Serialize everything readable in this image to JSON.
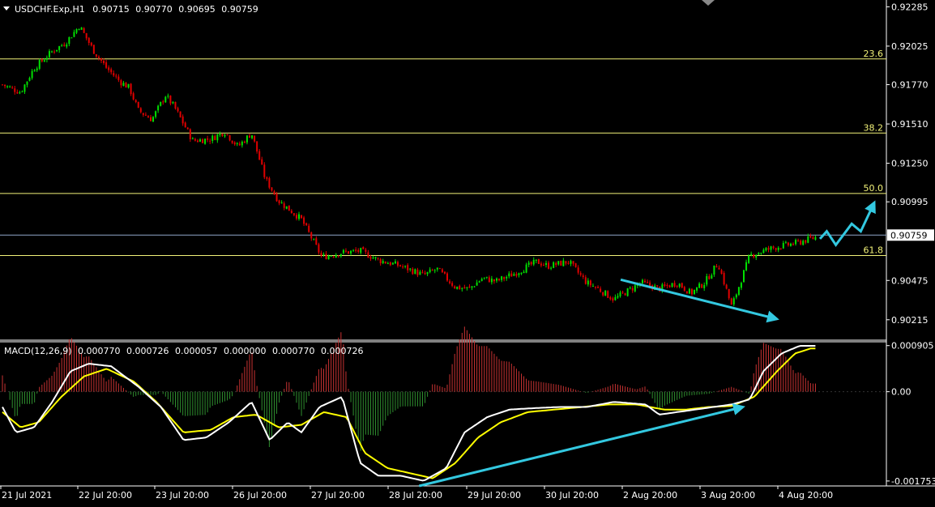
{
  "window": {
    "symbol_header": "USDCHF.Exp,H1",
    "ohlc": [
      "0.90715",
      "0.90770",
      "0.90695",
      "0.90759"
    ]
  },
  "colors": {
    "background": "#000000",
    "candle_up": "#00e000",
    "candle_down": "#e00000",
    "fib_line": "#f2f279",
    "price_line": "#8fa6c8",
    "macd_main": "#ffffff",
    "macd_signal": "#ffff00",
    "hist_pos": "#c83232",
    "hist_neg": "#2f8f2f",
    "arrow": "#33c8e0",
    "axis": "#ffffff"
  },
  "chart_data": [
    {
      "type": "candlestick",
      "title": "USDCHF.Exp,H1",
      "price_range": [
        0.9008,
        0.9233
      ],
      "y_ticks": [
        "0.92285",
        "0.92025",
        "0.91770",
        "0.91510",
        "0.91250",
        "0.90995",
        "0.90759",
        "0.90475",
        "0.90215"
      ],
      "current_price": "0.90759",
      "fib_levels": [
        {
          "label": "23.6",
          "price": 0.9194
        },
        {
          "label": "38.2",
          "price": 0.9145
        },
        {
          "label": "50.0",
          "price": 0.9105
        },
        {
          "label": "61.8",
          "price": 0.9064
        }
      ],
      "extra_lines": [
        {
          "price": 0.90775,
          "kind": "price-line"
        }
      ],
      "x_labels": [
        "21 Jul 2021",
        "22 Jul 20:00",
        "23 Jul 20:00",
        "26 Jul 20:00",
        "27 Jul 20:00",
        "28 Jul 20:00",
        "29 Jul 20:00",
        "30 Jul 20:00",
        "2 Aug 20:00",
        "3 Aug 20:00",
        "4 Aug 20:00"
      ],
      "bars_total": 215,
      "close_anchors": [
        [
          0,
          0.9177
        ],
        [
          8,
          0.9172
        ],
        [
          14,
          0.9188
        ],
        [
          22,
          0.9199
        ],
        [
          28,
          0.9205
        ],
        [
          34,
          0.9216
        ],
        [
          40,
          0.92
        ],
        [
          46,
          0.9188
        ],
        [
          52,
          0.9179
        ],
        [
          56,
          0.9175
        ],
        [
          60,
          0.916
        ],
        [
          66,
          0.9154
        ],
        [
          72,
          0.917
        ],
        [
          76,
          0.9162
        ],
        [
          84,
          0.914
        ],
        [
          92,
          0.9141
        ],
        [
          98,
          0.9146
        ],
        [
          104,
          0.9136
        ],
        [
          110,
          0.9145
        ],
        [
          116,
          0.9115
        ],
        [
          122,
          0.91
        ],
        [
          132,
          0.9088
        ],
        [
          141,
          0.9063
        ],
        [
          150,
          0.9066
        ],
        [
          158,
          0.9067
        ],
        [
          166,
          0.9061
        ],
        [
          176,
          0.9057
        ],
        [
          186,
          0.9051
        ],
        [
          192,
          0.9055
        ],
        [
          200,
          0.9043
        ],
        [
          206,
          0.9042
        ],
        [
          212,
          0.9049
        ],
        [
          218,
          0.9047
        ],
        [
          226,
          0.9052
        ],
        [
          236,
          0.906
        ],
        [
          241,
          0.9057
        ],
        [
          250,
          0.906
        ],
        [
          258,
          0.9046
        ],
        [
          262,
          0.9043
        ],
        [
          270,
          0.9035
        ],
        [
          282,
          0.9046
        ],
        [
          290,
          0.9042
        ],
        [
          298,
          0.9046
        ],
        [
          304,
          0.9039
        ],
        [
          310,
          0.9046
        ],
        [
          316,
          0.9059
        ],
        [
          322,
          0.903
        ],
        [
          330,
          0.9064
        ],
        [
          340,
          0.9069
        ],
        [
          350,
          0.9072
        ],
        [
          359,
          0.9076
        ]
      ],
      "projection": [
        [
          361,
          0.9075
        ],
        [
          364,
          0.908
        ],
        [
          368,
          0.9071
        ],
        [
          375,
          0.9085
        ],
        [
          379,
          0.908
        ],
        [
          385,
          0.9099
        ]
      ],
      "down_arrow": {
        "from": [
          273,
          0.9048
        ],
        "to": [
          342,
          0.9022
        ]
      }
    },
    {
      "type": "line",
      "title": "MACD(12,26,9)",
      "values_text": [
        "0.000770",
        "0.000726",
        "0.000057",
        "0.000000",
        "0.000770",
        "0.000726"
      ],
      "y_ticks": [
        "0.000905",
        "0.00",
        "-0.001753"
      ],
      "y_range": [
        -0.00185,
        0.00098
      ],
      "series": [
        {
          "name": "main",
          "anchors": [
            [
              0,
              -0.0003
            ],
            [
              6,
              -0.0008
            ],
            [
              14,
              -0.0007
            ],
            [
              22,
              -0.0002
            ],
            [
              30,
              0.0004
            ],
            [
              38,
              0.00055
            ],
            [
              48,
              0.0005
            ],
            [
              60,
              0.0001
            ],
            [
              70,
              -0.0003
            ],
            [
              80,
              -0.00095
            ],
            [
              90,
              -0.0009
            ],
            [
              100,
              -0.0006
            ],
            [
              110,
              -0.0002
            ],
            [
              118,
              -0.00095
            ],
            [
              126,
              -0.0006
            ],
            [
              132,
              -0.0008
            ],
            [
              140,
              -0.0003
            ],
            [
              150,
              -0.0001
            ],
            [
              158,
              -0.0014
            ],
            [
              166,
              -0.00165
            ],
            [
              176,
              -0.00165
            ],
            [
              186,
              -0.00175
            ],
            [
              196,
              -0.0015
            ],
            [
              204,
              -0.0008
            ],
            [
              214,
              -0.0005
            ],
            [
              224,
              -0.00035
            ],
            [
              236,
              -0.00032
            ],
            [
              246,
              -0.0003
            ],
            [
              258,
              -0.0003
            ],
            [
              270,
              -0.0002
            ],
            [
              284,
              -0.00025
            ],
            [
              290,
              -0.00045
            ],
            [
              298,
              -0.0004
            ],
            [
              306,
              -0.00035
            ],
            [
              314,
              -0.0003
            ],
            [
              322,
              -0.00025
            ],
            [
              330,
              -0.00015
            ],
            [
              336,
              0.0004
            ],
            [
              344,
              0.00075
            ],
            [
              352,
              0.0009
            ],
            [
              357,
              0.0009
            ]
          ]
        },
        {
          "name": "signal",
          "anchors": [
            [
              0,
              -0.0004
            ],
            [
              8,
              -0.0007
            ],
            [
              16,
              -0.0006
            ],
            [
              26,
              -0.0001
            ],
            [
              36,
              0.0003
            ],
            [
              46,
              0.00045
            ],
            [
              58,
              0.0002
            ],
            [
              68,
              -0.0002
            ],
            [
              80,
              -0.0008
            ],
            [
              92,
              -0.00075
            ],
            [
              102,
              -0.0005
            ],
            [
              112,
              -0.00045
            ],
            [
              122,
              -0.0007
            ],
            [
              132,
              -0.00065
            ],
            [
              142,
              -0.0004
            ],
            [
              152,
              -0.0005
            ],
            [
              160,
              -0.0012
            ],
            [
              170,
              -0.0015
            ],
            [
              180,
              -0.0016
            ],
            [
              190,
              -0.0017
            ],
            [
              200,
              -0.0014
            ],
            [
              210,
              -0.0009
            ],
            [
              220,
              -0.0006
            ],
            [
              232,
              -0.0004
            ],
            [
              244,
              -0.00035
            ],
            [
              256,
              -0.0003
            ],
            [
              268,
              -0.00025
            ],
            [
              280,
              -0.00025
            ],
            [
              292,
              -0.00035
            ],
            [
              302,
              -0.00035
            ],
            [
              312,
              -0.0003
            ],
            [
              322,
              -0.00028
            ],
            [
              332,
              -0.0001
            ],
            [
              342,
              0.0004
            ],
            [
              350,
              0.00075
            ],
            [
              357,
              0.00085
            ]
          ]
        }
      ],
      "up_arrow": {
        "from": [
          184,
          -0.00185
        ],
        "to": [
          327,
          -0.0003
        ]
      }
    }
  ]
}
